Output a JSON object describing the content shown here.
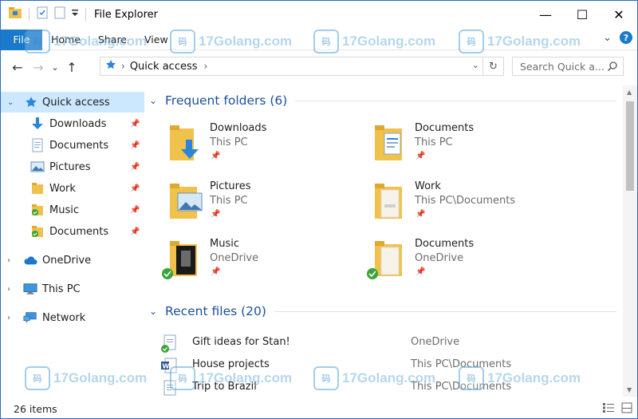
{
  "window": {
    "title": "File Explorer"
  },
  "caption": {
    "minimize": "—",
    "maximize": "☐",
    "close": "✕"
  },
  "ribbon": {
    "tabs": [
      "File",
      "Home",
      "Share",
      "View"
    ],
    "expand": "⌄",
    "help": "?"
  },
  "nav": {
    "back": "←",
    "forward": "→",
    "recent": "⌄",
    "up": "↑"
  },
  "address": {
    "crumb": "Quick access",
    "chevron": "›",
    "dropdown": "⌄",
    "refresh": "↻"
  },
  "search": {
    "placeholder": "Search Quick a..."
  },
  "sidebar": {
    "quick_access": "Quick access",
    "pinned": [
      {
        "label": "Downloads",
        "icon": "download-arrow-icon"
      },
      {
        "label": "Documents",
        "icon": "document-icon"
      },
      {
        "label": "Pictures",
        "icon": "picture-icon"
      },
      {
        "label": "Work",
        "icon": "folder-icon"
      },
      {
        "label": "Music",
        "icon": "folder-synced-icon"
      },
      {
        "label": "Documents",
        "icon": "folder-synced-icon"
      }
    ],
    "onedrive": "OneDrive",
    "thispc": "This PC",
    "network": "Network"
  },
  "frequent": {
    "title": "Frequent folders (6)",
    "items": [
      {
        "name": "Downloads",
        "location": "This PC"
      },
      {
        "name": "Documents",
        "location": "This PC"
      },
      {
        "name": "Pictures",
        "location": "This PC"
      },
      {
        "name": "Work",
        "location": "This PC\\Documents"
      },
      {
        "name": "Music",
        "location": "OneDrive"
      },
      {
        "name": "Documents",
        "location": "OneDrive"
      }
    ]
  },
  "recent": {
    "title": "Recent files (20)",
    "items": [
      {
        "name": "Gift ideas for Stan!",
        "location": "OneDrive"
      },
      {
        "name": "House projects",
        "location": "This PC\\Documents"
      },
      {
        "name": "Trip to Brazil",
        "location": "This PC\\Documents"
      }
    ]
  },
  "status": {
    "count": "26 items"
  },
  "watermark": {
    "text": "17Golang.com",
    "badge": "码"
  },
  "colors": {
    "accent": "#1979ca",
    "selection": "#cce8ff",
    "section_title": "#1c4f9c",
    "folder": "#f0c14b"
  }
}
